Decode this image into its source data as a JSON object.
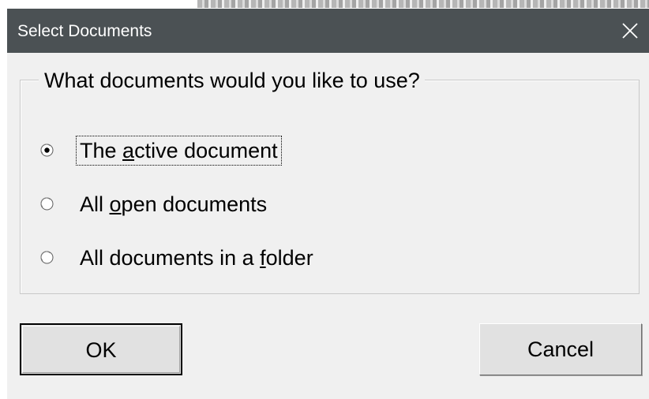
{
  "dialog": {
    "title": "Select Documents",
    "close_icon": "close-icon"
  },
  "group": {
    "legend": "What documents would you like to use?",
    "options": [
      {
        "label_before": "The ",
        "accel": "a",
        "label_after": "ctive document",
        "selected": true
      },
      {
        "label_before": "All ",
        "accel": "o",
        "label_after": "pen documents",
        "selected": false
      },
      {
        "label_before": "All documents in a ",
        "accel": "f",
        "label_after": "older",
        "selected": false
      }
    ]
  },
  "buttons": {
    "ok_label": "OK",
    "cancel_label": "Cancel"
  },
  "colors": {
    "titlebar": "#4b5154",
    "dialog_bg": "#f0f0f0",
    "button_bg": "#e1e1e1"
  }
}
